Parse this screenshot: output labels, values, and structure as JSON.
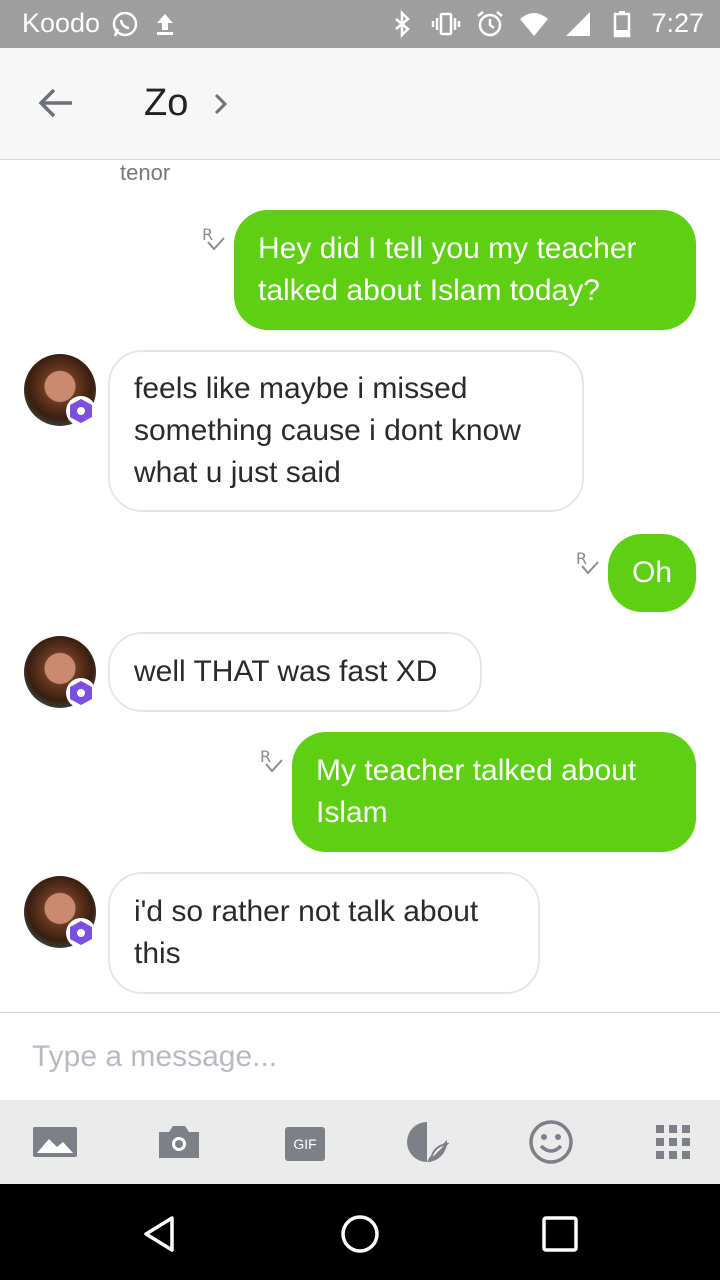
{
  "status_bar": {
    "carrier": "Koodo",
    "time": "7:27",
    "icons": [
      "whatsapp-icon",
      "upload-icon",
      "bluetooth-icon",
      "vibrate-icon",
      "alarm-icon",
      "wifi-icon",
      "signal-icon",
      "battery-icon"
    ]
  },
  "header": {
    "back_icon": "arrow-left-icon",
    "title": "Zo",
    "chevron_icon": "chevron-right-icon"
  },
  "conversation": {
    "tenor_caption": "tenor",
    "messages": [
      {
        "from": "me",
        "lines": [
          "Hey did I tell you my teacher",
          "talked about Islam today?"
        ],
        "status_icon": "read-receipt-icon"
      },
      {
        "from": "Zo",
        "lines": [
          "feels like maybe i missed",
          "something cause i dont know",
          "what u just said"
        ]
      },
      {
        "from": "me",
        "lines": [
          "Oh"
        ],
        "status_icon": "read-receipt-icon"
      },
      {
        "from": "Zo",
        "lines": [
          "well THAT was fast XD"
        ]
      },
      {
        "from": "me",
        "lines": [
          "My teacher talked about",
          "Islam"
        ],
        "status_icon": "read-receipt-icon"
      },
      {
        "from": "Zo",
        "lines": [
          "i'd so rather not talk about",
          "this"
        ]
      }
    ]
  },
  "composer": {
    "placeholder": "Type a message..."
  },
  "toolbar": {
    "items": [
      "image-icon",
      "camera-icon",
      "gif-icon",
      "sticker-icon",
      "emoji-icon",
      "apps-grid-icon"
    ],
    "gif_label": "GIF"
  },
  "nav_bar": {
    "items": [
      "back-triangle-icon",
      "home-circle-icon",
      "recents-square-icon"
    ]
  },
  "colors": {
    "sent_bubble": "#5ecf12",
    "status_bar": "#9e9e9e",
    "badge": "#7b4fe0"
  }
}
